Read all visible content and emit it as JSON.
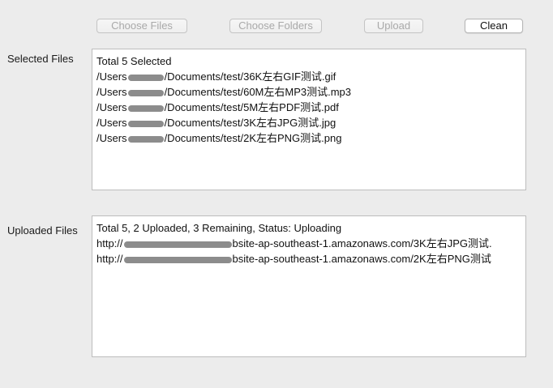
{
  "toolbar": {
    "choose_files": "Choose Files",
    "choose_folders": "Choose Folders",
    "upload": "Upload",
    "clean": "Clean"
  },
  "selected": {
    "label": "Selected Files",
    "summary": "Total 5 Selected",
    "items": [
      {
        "prefix": "/Users",
        "suffix": "/Documents/test/36K左右GIF测试.gif"
      },
      {
        "prefix": "/Users",
        "suffix": "/Documents/test/60M左右MP3测试.mp3"
      },
      {
        "prefix": "/Users",
        "suffix": "/Documents/test/5M左右PDF测试.pdf"
      },
      {
        "prefix": "/Users",
        "suffix": "/Documents/test/3K左右JPG测试.jpg"
      },
      {
        "prefix": "/Users",
        "suffix": "/Documents/test/2K左右PNG测试.png"
      }
    ]
  },
  "uploaded": {
    "label": "Uploaded Files",
    "summary": "Total 5, 2 Uploaded, 3 Remaining, Status: Uploading",
    "items": [
      {
        "prefix": "http://",
        "suffix": "bsite-ap-southeast-1.amazonaws.com/3K左右JPG测试."
      },
      {
        "prefix": "http://",
        "suffix": "bsite-ap-southeast-1.amazonaws.com/2K左右PNG测试"
      }
    ]
  },
  "colors": {
    "window_bg": "#ececec",
    "field_bg": "#ffffff",
    "disabled_text": "#a9a9a9",
    "redaction": "#8c8c8c"
  }
}
